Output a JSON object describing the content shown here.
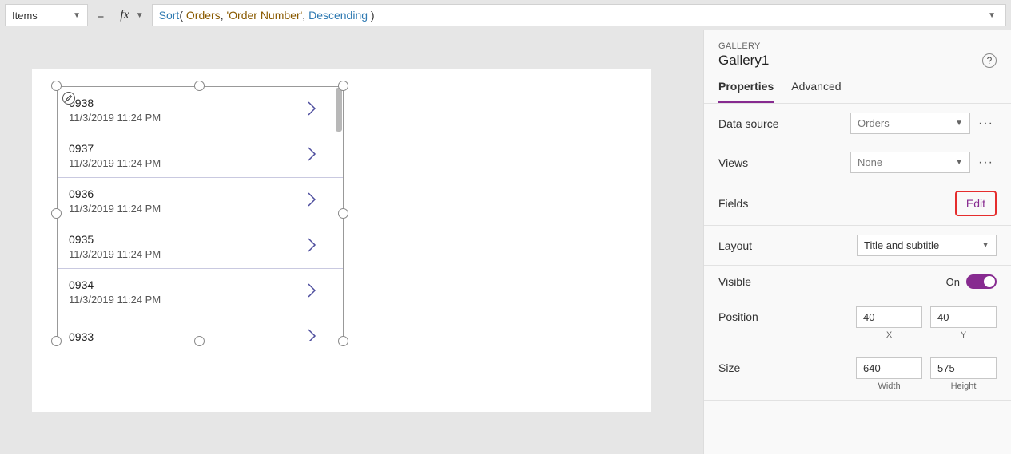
{
  "formulaBar": {
    "propertyLabel": "Items",
    "equals": "=",
    "fx": "fx",
    "formula": {
      "fn": "Sort",
      "open": "( ",
      "arg1": "Orders",
      "sep1": ", ",
      "arg2": "'Order Number'",
      "sep2": ", ",
      "arg3": "Descending",
      "close": " )"
    }
  },
  "gallery": {
    "items": [
      {
        "title": "0938",
        "subtitle": "11/3/2019 11:24 PM"
      },
      {
        "title": "0937",
        "subtitle": "11/3/2019 11:24 PM"
      },
      {
        "title": "0936",
        "subtitle": "11/3/2019 11:24 PM"
      },
      {
        "title": "0935",
        "subtitle": "11/3/2019 11:24 PM"
      },
      {
        "title": "0934",
        "subtitle": "11/3/2019 11:24 PM"
      },
      {
        "title": "0933",
        "subtitle": ""
      }
    ]
  },
  "panel": {
    "type": "GALLERY",
    "name": "Gallery1",
    "tabs": {
      "properties": "Properties",
      "advanced": "Advanced"
    },
    "dataSourceLabel": "Data source",
    "dataSourceValue": "Orders",
    "viewsLabel": "Views",
    "viewsValue": "None",
    "fieldsLabel": "Fields",
    "fieldsEdit": "Edit",
    "layoutLabel": "Layout",
    "layoutValue": "Title and subtitle",
    "visibleLabel": "Visible",
    "visibleValue": "On",
    "positionLabel": "Position",
    "positionX": "40",
    "positionY": "40",
    "positionXLabel": "X",
    "positionYLabel": "Y",
    "sizeLabel": "Size",
    "sizeW": "640",
    "sizeH": "575",
    "sizeWLabel": "Width",
    "sizeHLabel": "Height"
  }
}
